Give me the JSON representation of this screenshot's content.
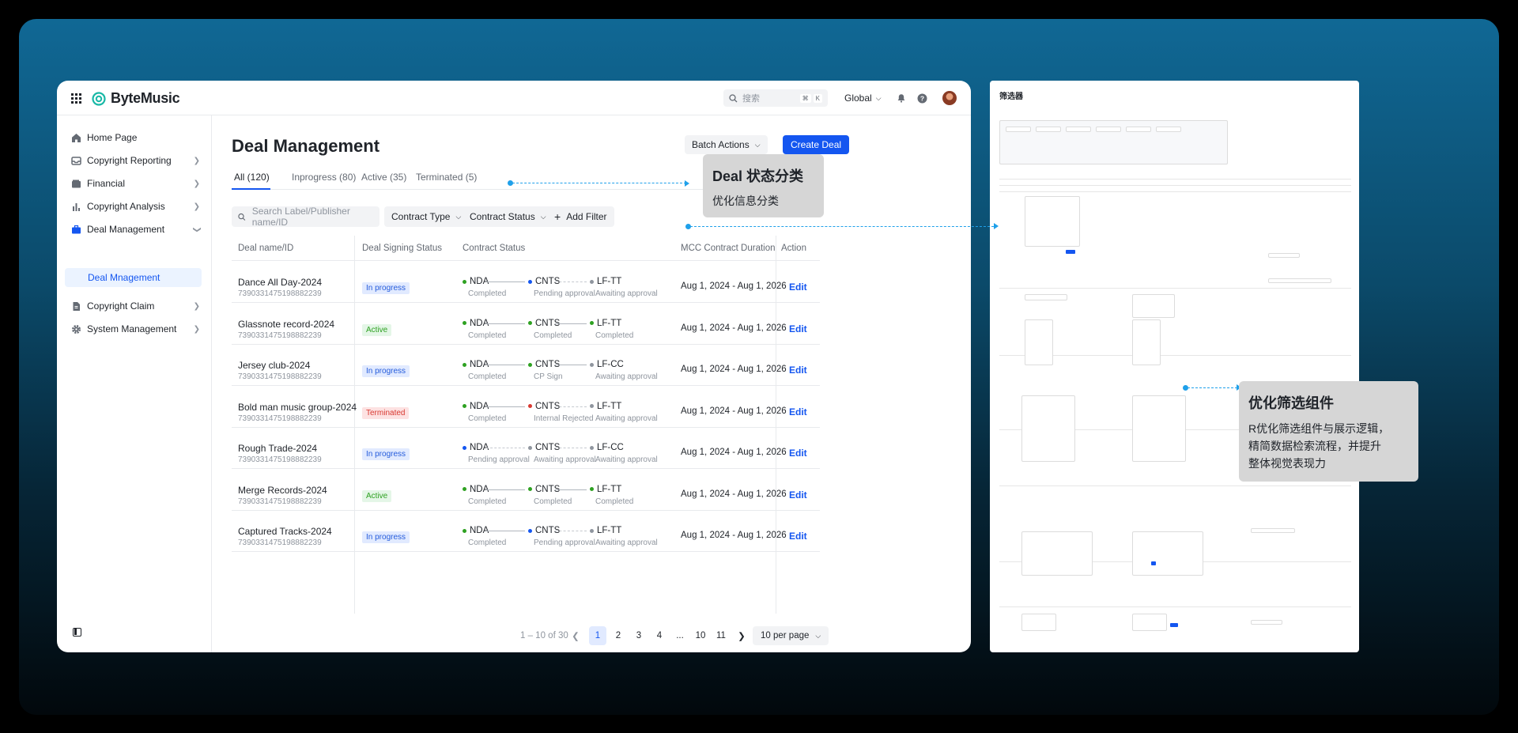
{
  "app": {
    "brand": "ByteMusic",
    "search_placeholder": "搜索",
    "search_kbd": [
      "⌘",
      "K"
    ],
    "region": "Global"
  },
  "sidebar": {
    "items": [
      {
        "label": "Home Page",
        "icon": "home-icon",
        "expandable": false
      },
      {
        "label": "Copyright Reporting",
        "icon": "inbox-icon",
        "expandable": true
      },
      {
        "label": "Financial",
        "icon": "wallet-icon",
        "expandable": true
      },
      {
        "label": "Copyright Analysis",
        "icon": "bar-chart-icon",
        "expandable": true
      },
      {
        "label": "Deal Management",
        "icon": "briefcase-icon",
        "expandable": true,
        "expanded": true
      },
      {
        "label": "Copyright Claim",
        "icon": "document-icon",
        "expandable": true
      },
      {
        "label": "System Management",
        "icon": "gear-icon",
        "expandable": true
      }
    ],
    "sub_item": "Deal Mnagement"
  },
  "page": {
    "title": "Deal Management",
    "batch_actions": "Batch Actions",
    "create_deal": "Create Deal",
    "tabs": [
      "All (120)",
      "Inprogress (80)",
      "Active (35)",
      "Terminated (5)"
    ],
    "search_placeholder": "Search Label/Publisher name/ID",
    "filters": [
      "Contract Type",
      "Contract Status"
    ],
    "add_filter": "Add Filter"
  },
  "table": {
    "columns": [
      "Deal name/ID",
      "Deal Signing Status",
      "Contract Status",
      "MCC Contract Duration",
      "Action"
    ],
    "rows": [
      {
        "name": "Dance All Day-2024",
        "id": "7390331475198882239",
        "status": "In progress",
        "status_kind": "inprogress",
        "steps": [
          {
            "name": "NDA",
            "sub": "Completed",
            "color": "#2ea121"
          },
          {
            "name": "CNTS",
            "sub": "Pending approval",
            "color": "#1456f0"
          },
          {
            "name": "LF-TT",
            "sub": "Awaiting approval",
            "color": "#8f959e"
          }
        ],
        "duration": "Aug 1, 2024 - Aug 1, 2026",
        "action": "Edit"
      },
      {
        "name": "Glassnote record-2024",
        "id": "7390331475198882239",
        "status": "Active",
        "status_kind": "active",
        "steps": [
          {
            "name": "NDA",
            "sub": "Completed",
            "color": "#2ea121"
          },
          {
            "name": "CNTS",
            "sub": "Completed",
            "color": "#2ea121"
          },
          {
            "name": "LF-TT",
            "sub": "Completed",
            "color": "#2ea121"
          }
        ],
        "duration": "Aug 1, 2024 - Aug 1, 2026",
        "action": "Edit"
      },
      {
        "name": "Jersey club-2024",
        "id": "7390331475198882239",
        "status": "In progress",
        "status_kind": "inprogress",
        "steps": [
          {
            "name": "NDA",
            "sub": "Completed",
            "color": "#2ea121"
          },
          {
            "name": "CNTS",
            "sub": "CP Sign",
            "color": "#2ea121"
          },
          {
            "name": "LF-CC",
            "sub": "Awaiting approval",
            "color": "#8f959e"
          }
        ],
        "duration": "Aug 1, 2024 - Aug 1, 2026",
        "action": "Edit"
      },
      {
        "name": "Bold man music group-2024",
        "id": "7390331475198882239",
        "status": "Terminated",
        "status_kind": "terminated",
        "steps": [
          {
            "name": "NDA",
            "sub": "Completed",
            "color": "#2ea121"
          },
          {
            "name": "CNTS",
            "sub": "Internal Rejected",
            "color": "#d83931"
          },
          {
            "name": "LF-TT",
            "sub": "Awaiting approval",
            "color": "#8f959e"
          }
        ],
        "duration": "Aug 1, 2024 - Aug 1, 2026",
        "action": "Edit"
      },
      {
        "name": "Rough Trade-2024",
        "id": "7390331475198882239",
        "status": "In progress",
        "status_kind": "inprogress",
        "steps": [
          {
            "name": "NDA",
            "sub": "Pending approval",
            "color": "#1456f0"
          },
          {
            "name": "CNTS",
            "sub": "Awaiting approval",
            "color": "#8f959e"
          },
          {
            "name": "LF-CC",
            "sub": "Awaiting approval",
            "color": "#8f959e"
          }
        ],
        "duration": "Aug 1, 2024 - Aug 1, 2026",
        "action": "Edit"
      },
      {
        "name": "Merge Records-2024",
        "id": "7390331475198882239",
        "status": "Active",
        "status_kind": "active",
        "steps": [
          {
            "name": "NDA",
            "sub": "Completed",
            "color": "#2ea121"
          },
          {
            "name": "CNTS",
            "sub": "Completed",
            "color": "#2ea121"
          },
          {
            "name": "LF-TT",
            "sub": "Completed",
            "color": "#2ea121"
          }
        ],
        "duration": "Aug 1, 2024 - Aug 1, 2026",
        "action": "Edit"
      },
      {
        "name": "Captured Tracks-2024",
        "id": "7390331475198882239",
        "status": "In progress",
        "status_kind": "inprogress",
        "steps": [
          {
            "name": "NDA",
            "sub": "Completed",
            "color": "#2ea121"
          },
          {
            "name": "CNTS",
            "sub": "Pending approval",
            "color": "#1456f0"
          },
          {
            "name": "LF-TT",
            "sub": "Awaiting approval",
            "color": "#8f959e"
          }
        ],
        "duration": "Aug 1, 2024 - Aug 1, 2026",
        "action": "Edit"
      }
    ]
  },
  "pagination": {
    "range": "1 – 10 of 30",
    "pages": [
      "1",
      "2",
      "3",
      "4",
      "...",
      "10",
      "11"
    ],
    "current": "1",
    "per_page": "10 per page"
  },
  "annotations": {
    "status_title": "Deal 状态分类",
    "status_desc": "优化信息分类",
    "filter_title": "优化筛选组件",
    "filter_desc_lines": [
      "R优化筛选组件与展示逻辑，",
      "精简数据检索流程，并提升",
      "整体视觉表现力"
    ]
  },
  "filter_panel": {
    "title": "筛选器"
  },
  "colors": {
    "primary": "#1456f0",
    "accent_arrow": "#1fa0ea",
    "completed": "#2ea121",
    "rejected": "#d83931"
  }
}
